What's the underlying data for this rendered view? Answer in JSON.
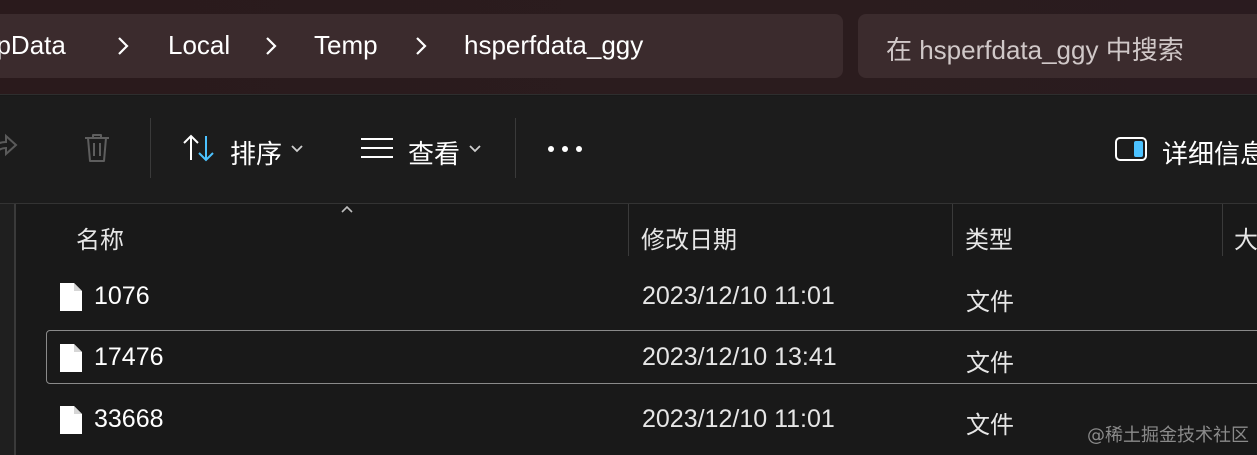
{
  "breadcrumb": {
    "items": [
      "ppData",
      "Local",
      "Temp",
      "hsperfdata_ggy"
    ]
  },
  "search": {
    "placeholder": "在 hsperfdata_ggy 中搜索"
  },
  "toolbar": {
    "sort_label": "排序",
    "view_label": "查看",
    "details_label": "详细信息"
  },
  "columns": {
    "name": "名称",
    "modified": "修改日期",
    "type": "类型",
    "size": "大"
  },
  "files": [
    {
      "name": "1076",
      "modified": "2023/12/10 11:01",
      "type": "文件",
      "selected": false
    },
    {
      "name": "17476",
      "modified": "2023/12/10 13:41",
      "type": "文件",
      "selected": true
    },
    {
      "name": "33668",
      "modified": "2023/12/10 11:01",
      "type": "文件",
      "selected": false
    }
  ],
  "watermark": "@稀土掘金技术社区",
  "colors": {
    "accent": "#4cc2ff",
    "background": "#191919",
    "titlebar": "#2a1a1c",
    "addressbar": "#3b2b2d"
  }
}
